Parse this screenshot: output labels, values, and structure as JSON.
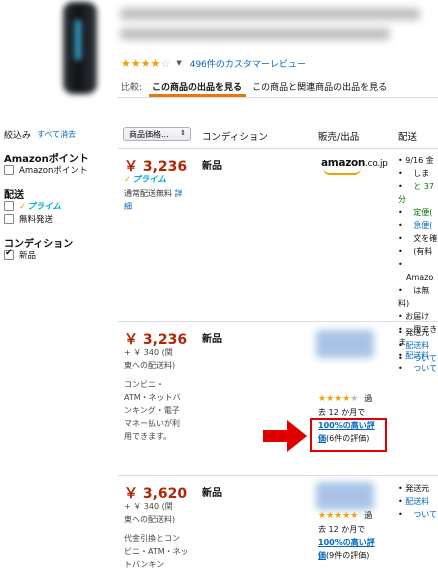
{
  "product": {
    "rating_value": 3.5,
    "review_link": "496件のカスタマーレビュー"
  },
  "compare": {
    "label": "比較:",
    "tabs": [
      {
        "label": "この商品の出品を見る",
        "active": true
      },
      {
        "label": "この商品と関連商品の出品を見る",
        "active": false
      }
    ]
  },
  "sidebar": {
    "filter_label": "絞込み",
    "clear_all": "すべて消去",
    "sections": [
      {
        "title": "Amazonポイント",
        "options": [
          {
            "label": "Amazonポイント",
            "checked": false
          }
        ]
      },
      {
        "title": "配送",
        "options": [
          {
            "label": "プライム",
            "checked": false,
            "icon": "prime-logo"
          },
          {
            "label": "無料発送",
            "checked": false
          }
        ]
      },
      {
        "title": "コンディション",
        "options": [
          {
            "label": "新品",
            "checked": true
          }
        ]
      }
    ]
  },
  "table": {
    "sort_label": "商品価格...",
    "headers": {
      "condition": "コンディション",
      "seller": "販売/出品",
      "delivery": "配送"
    }
  },
  "offers": [
    {
      "price": "￥ 3,236",
      "prime_label": "プライム",
      "shipping_note_1": "通常配送無料",
      "shipping_link_a": "詳",
      "shipping_link_b": "細",
      "condition": "新品",
      "seller_logo_text": "amazon",
      "seller_logo_domain": ".co.jp",
      "delivery_lines": [
        "9/16 金",
        "しま",
        "と 37 分",
        "定便(",
        "急便(",
        "文を確",
        "(有料",
        "Amazo",
        "は無料)",
        "お届け",
        "用できま",
        "配送料",
        "ついて"
      ]
    },
    {
      "price": "￥ 3,236",
      "sub_lines": [
        "+ ￥ 340 (関",
        "東への配送料)",
        "",
        "コンビニ・",
        "ATM・ネットバ",
        "ンキング・電子",
        "マネー払いが利",
        "用できます。"
      ],
      "condition": "新品",
      "seller_rating": 4.5,
      "seller_period_a": "過",
      "seller_period_b": "去 12 か月で",
      "seller_feedback_link": "100%の高い評",
      "seller_feedback_link_2": "価",
      "seller_feedback_count": "(6件の評価)",
      "delivery_lines": [
        "発送元",
        "配送料",
        "ついて"
      ]
    },
    {
      "price": "￥ 3,620",
      "sub_lines": [
        "+ ￥ 340 (関",
        "東への配送料)",
        "",
        "代金引換とコン",
        "ビニ・ATM・ネッ",
        "トバンキン"
      ],
      "condition": "新品",
      "seller_rating": 5,
      "seller_period_a": "過",
      "seller_period_b": "去 12 か月で",
      "seller_feedback_link": "100%の高い評",
      "seller_feedback_link_2": "価",
      "seller_feedback_count": "(9件の評価)",
      "delivery_lines": [
        "発送元",
        "配送料",
        "ついて"
      ]
    }
  ],
  "colors": {
    "price": "#b12704",
    "link": "#0066c0",
    "tab_active_underline": "#e47911",
    "highlight": "#e00000",
    "prime": "#00a8e1",
    "star": "#f0a000"
  }
}
